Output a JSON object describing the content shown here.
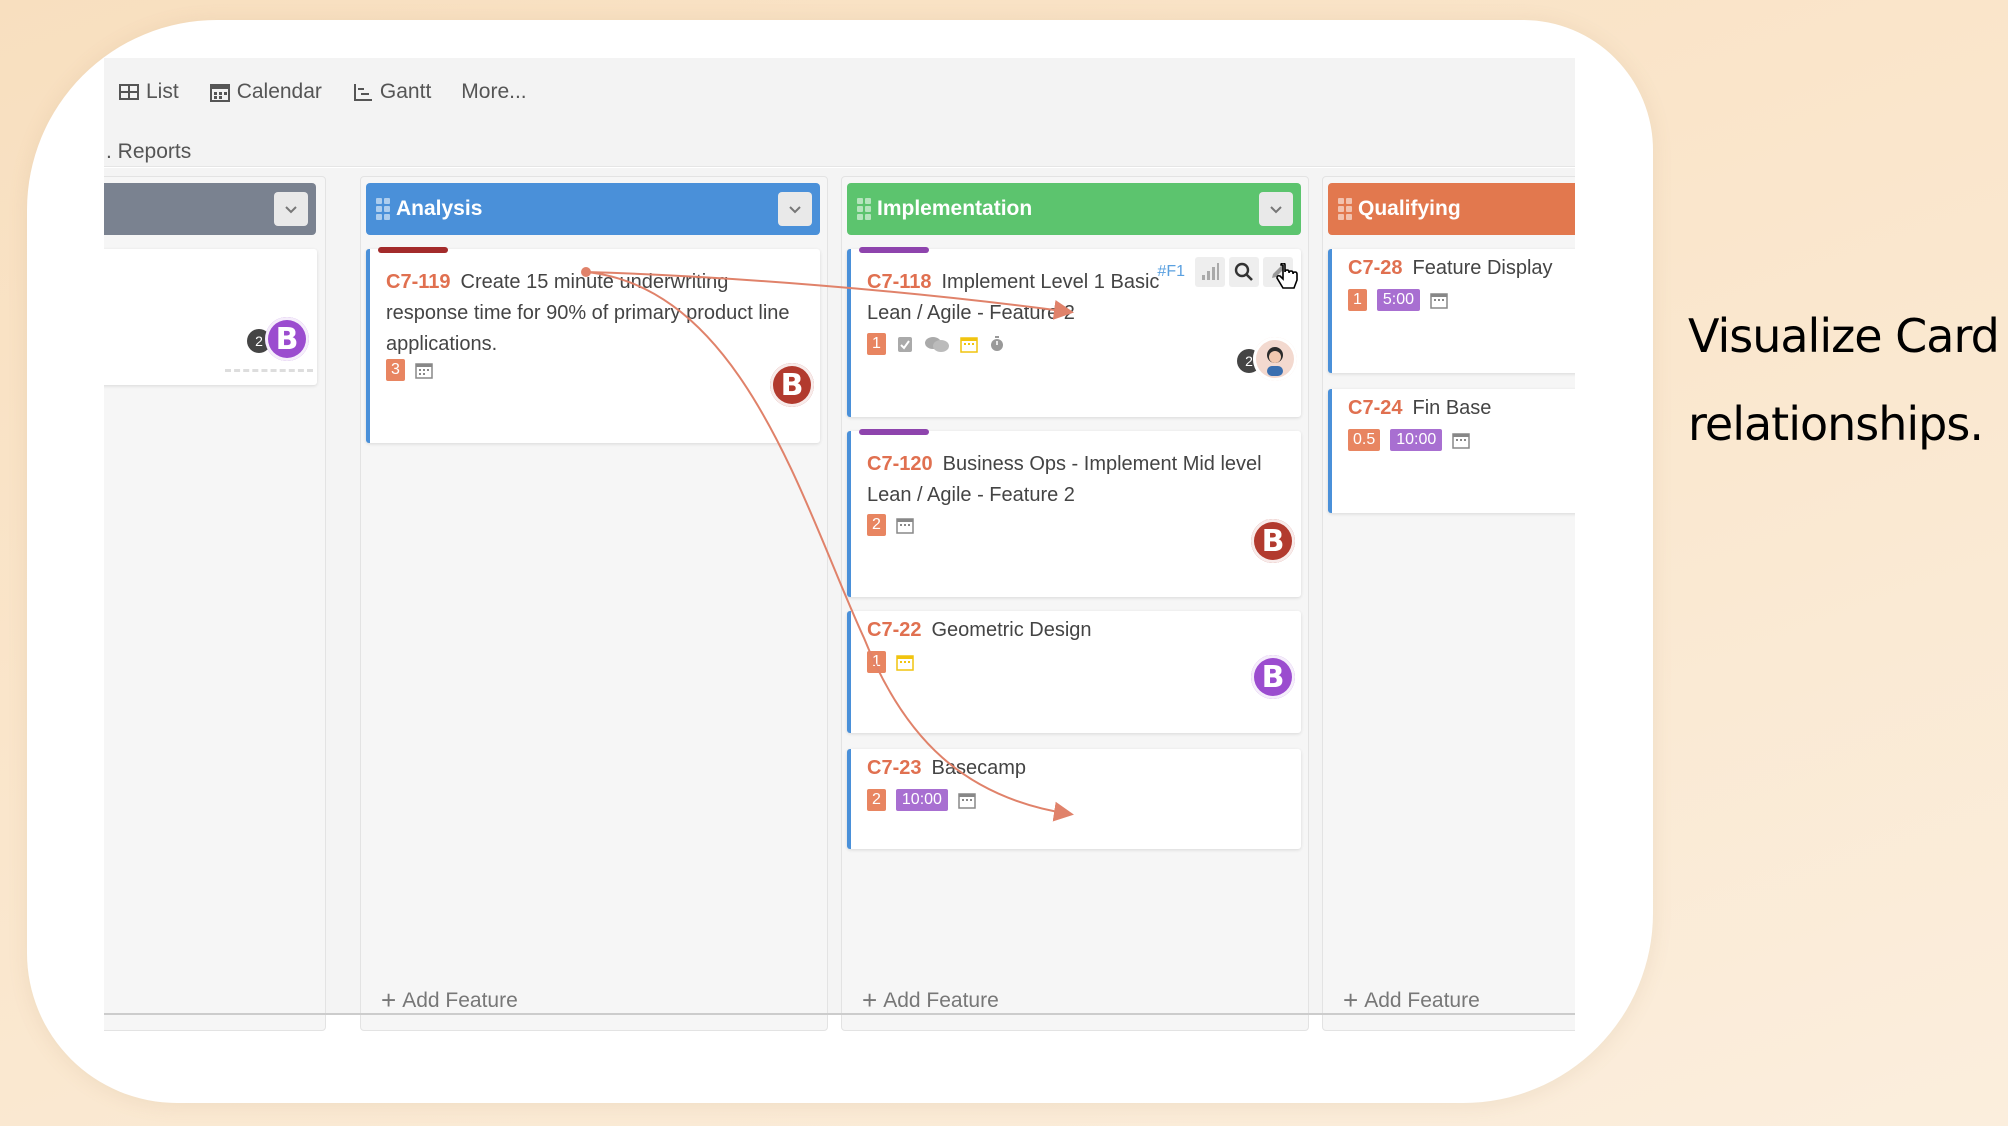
{
  "nav": {
    "tabs": [
      {
        "label": "List",
        "icon": "table-icon"
      },
      {
        "label": "Calendar",
        "icon": "calendar-icon"
      },
      {
        "label": "Gantt",
        "icon": "gantt-icon"
      },
      {
        "label": "More...",
        "icon": ""
      }
    ],
    "reports": ". Reports"
  },
  "columns": [
    {
      "title": "",
      "color": "#7a8290"
    },
    {
      "title": "Analysis",
      "color": "#4a90d9",
      "add_label": "Add Feature"
    },
    {
      "title": "Implementation",
      "color": "#5cc46e",
      "add_label": "Add Feature"
    },
    {
      "title": "Qualifying",
      "color": "#e2784e",
      "add_label": "Add Feature"
    }
  ],
  "cards": {
    "c119": {
      "id": "C7-119",
      "title": "Create 15 minute underwriting response time for 90% of primary product line applications.",
      "points": "3",
      "avatar": "B",
      "bar_color": "#a32b2b"
    },
    "c118": {
      "id": "C7-118",
      "title": "Implement Level 1 Basic Lean / Agile - Feature 2",
      "points": "1",
      "tag": "#F1",
      "avatar_count": "2",
      "bar_color": "#8e44ad"
    },
    "c120": {
      "id": "C7-120",
      "title": "Business Ops - Implement Mid level Lean / Agile - Feature 2",
      "points": "2",
      "avatar": "B",
      "bar_color": "#8e44ad"
    },
    "c22": {
      "id": "C7-22",
      "title": "Geometric Design",
      "points": "1",
      "avatar": "B"
    },
    "c23": {
      "id": "C7-23",
      "title": "Basecamp",
      "points": "2",
      "time": "10:00"
    },
    "c28": {
      "id": "C7-28",
      "title": "Feature Display",
      "points": "1",
      "time": "5:00"
    },
    "c24": {
      "id": "C7-24",
      "title": "Fin Base",
      "points": "0.5",
      "time": "10:00"
    },
    "c_left": {
      "avatar": "B",
      "avatar_count": "2"
    }
  },
  "colors": {
    "accent_red": "#e07050",
    "link_line": "#e0826a",
    "purple": "#a86fd1"
  },
  "tagline": {
    "line1": "Visualize Card",
    "line2": "relationships."
  }
}
